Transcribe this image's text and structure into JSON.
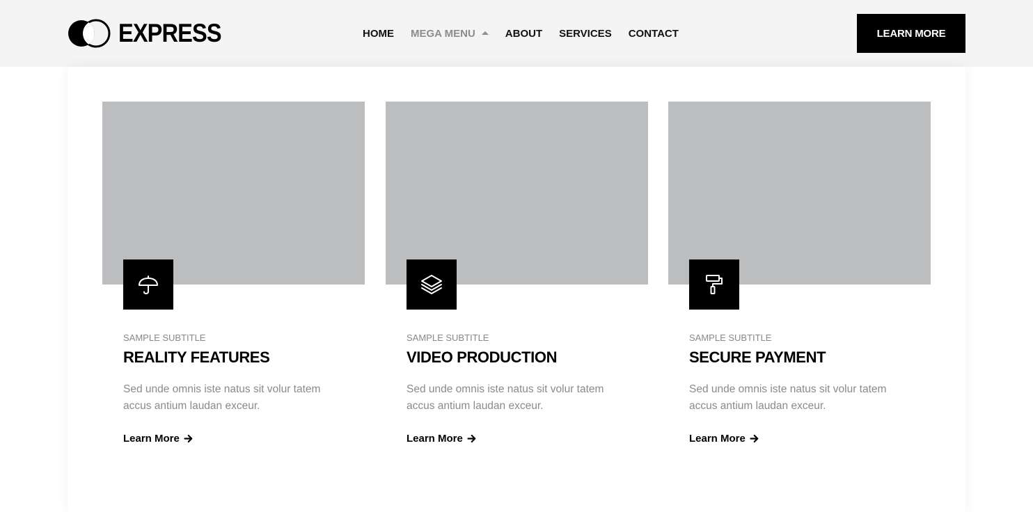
{
  "brand": {
    "name": "EXPRESS"
  },
  "nav": {
    "items": [
      {
        "label": "HOME"
      },
      {
        "label": "MEGA MENU"
      },
      {
        "label": "ABOUT"
      },
      {
        "label": "SERVICES"
      },
      {
        "label": "CONTACT"
      }
    ]
  },
  "header": {
    "cta_label": "LEARN MORE"
  },
  "cards": [
    {
      "icon": "umbrella-icon",
      "subtitle": "SAMPLE SUBTITLE",
      "title": "REALITY FEATURES",
      "text": "Sed unde omnis iste natus sit volur tatem accus antium laudan exceur.",
      "link": "Learn More"
    },
    {
      "icon": "layers-icon",
      "subtitle": "SAMPLE SUBTITLE",
      "title": "VIDEO PRODUCTION",
      "text": "Sed unde omnis iste natus sit volur tatem accus antium laudan exceur.",
      "link": "Learn More"
    },
    {
      "icon": "paint-roller-icon",
      "subtitle": "SAMPLE SUBTITLE",
      "title": "SECURE PAYMENT",
      "text": "Sed unde omnis iste natus sit volur tatem accus antium laudan exceur.",
      "link": "Learn More"
    }
  ],
  "colors": {
    "header_bg": "#f4f4f4",
    "accent": "#000000",
    "active_nav": "#8c8c8c",
    "image_placeholder": "#bcbdbf",
    "muted_text": "#8a8a8a"
  }
}
